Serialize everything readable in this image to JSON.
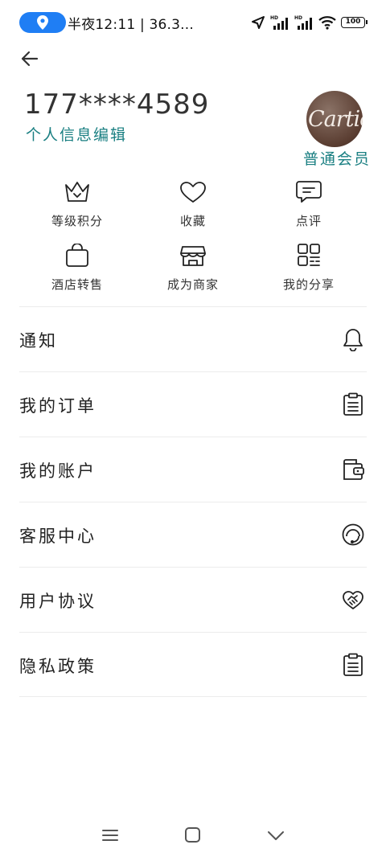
{
  "status_bar": {
    "time_text": "半夜12:11 | 36.3...",
    "battery": "100",
    "accent": "#1f7ef4"
  },
  "header": {
    "phone": "177****4589",
    "edit_profile": "个人信息编辑",
    "avatar_text": "Cartier",
    "member_level": "普通会员",
    "accent": "#1a7f82"
  },
  "quick_actions": [
    {
      "label": "等级积分",
      "icon": "crown-icon"
    },
    {
      "label": "收藏",
      "icon": "heart-icon"
    },
    {
      "label": "点评",
      "icon": "comment-icon"
    },
    {
      "label": "酒店转售",
      "icon": "shopping-bag-icon"
    },
    {
      "label": "成为商家",
      "icon": "store-icon"
    },
    {
      "label": "我的分享",
      "icon": "share-grid-icon"
    }
  ],
  "menu": [
    {
      "label": "通知",
      "icon": "bell-icon"
    },
    {
      "label": "我的订单",
      "icon": "clipboard-icon"
    },
    {
      "label": "我的账户",
      "icon": "wallet-icon"
    },
    {
      "label": "客服中心",
      "icon": "headset-icon"
    },
    {
      "label": "用户协议",
      "icon": "handshake-icon"
    },
    {
      "label": "隐私政策",
      "icon": "clipboard-icon"
    }
  ]
}
